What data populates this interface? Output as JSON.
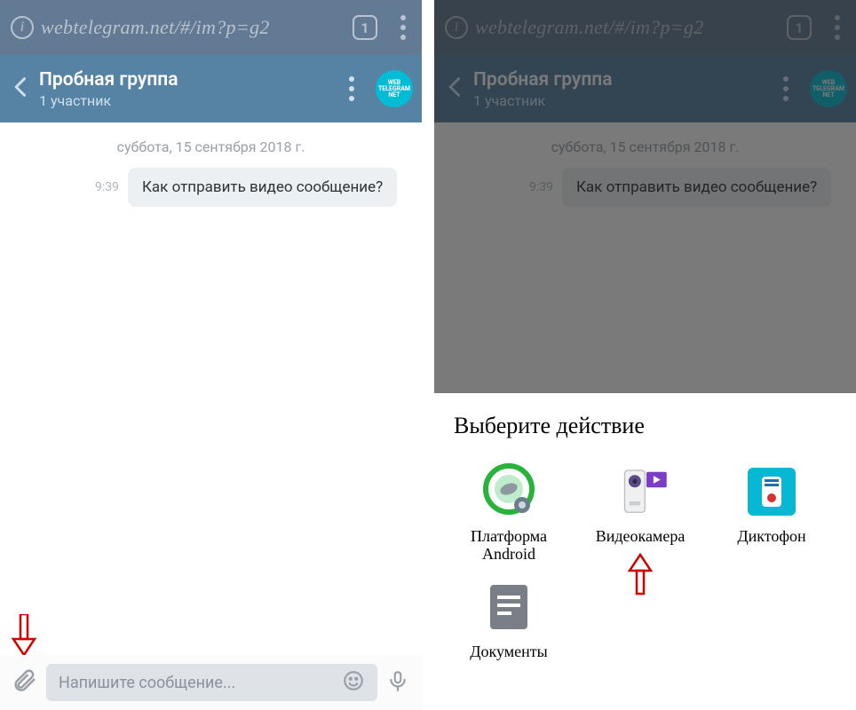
{
  "browser": {
    "url": "webtelegram.net/#/im?p=g2",
    "tabs_count": "1"
  },
  "chat": {
    "title": "Пробная группа",
    "subtitle": "1 участник",
    "avatar_lines": [
      "WEB",
      "TELEGRAM",
      "NET"
    ]
  },
  "body": {
    "date": "суббота, 15 сентября 2018 г.",
    "msg_time": "9:39",
    "msg_text": "Как отправить видео сообщение?"
  },
  "input": {
    "placeholder": "Напишите сообщение..."
  },
  "sheet": {
    "title": "Выберите действие",
    "actions": [
      {
        "label": "Платформа Android"
      },
      {
        "label": "Видеокамера"
      },
      {
        "label": "Диктофон"
      },
      {
        "label": "Документы"
      }
    ]
  }
}
